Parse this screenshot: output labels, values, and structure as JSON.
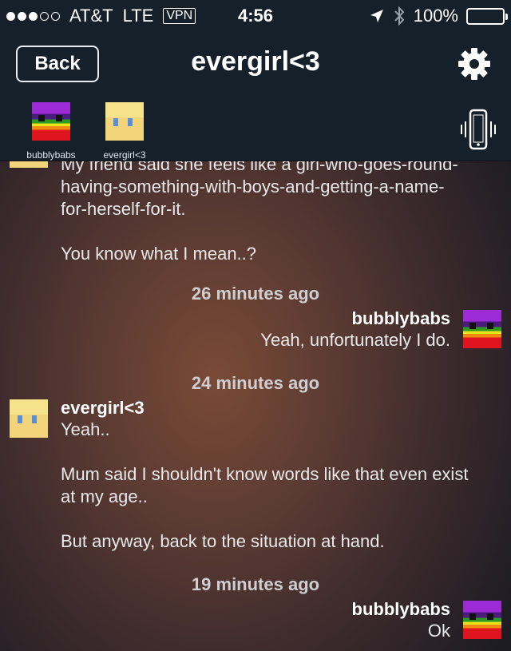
{
  "status_bar": {
    "carrier": "AT&T",
    "network": "LTE",
    "vpn": "VPN",
    "time": "4:56",
    "battery": "100%"
  },
  "nav": {
    "back_label": "Back",
    "title": "evergirl<3",
    "settings_icon": "gear-icon"
  },
  "participants": [
    {
      "name": "bubblybabs",
      "avatar": "rainbow-pixel-avatar"
    },
    {
      "name": "evergirl<3",
      "avatar": "blonde-pixel-avatar"
    }
  ],
  "messages": {
    "m1": {
      "text_clipped": "My friend said she feels like a girl-who-goes-round-",
      "line2": "having-something-with-boys-and-getting-a-name-",
      "line3": "for-herself-for-it.",
      "line4": "You know what I mean..?"
    },
    "t1": "26 minutes ago",
    "m2": {
      "sender": "bubblybabs",
      "text": "Yeah, unfortunately I do."
    },
    "t2": "24 minutes ago",
    "m3": {
      "sender": "evergirl<3",
      "line1": "Yeah..",
      "line2": "Mum said I shouldn't know words like that even exist",
      "line3": "at my age..",
      "line4": "But anyway, back to the situation at hand."
    },
    "t3": "19 minutes ago",
    "m4": {
      "sender": "bubblybabs",
      "text": "Ok"
    }
  }
}
